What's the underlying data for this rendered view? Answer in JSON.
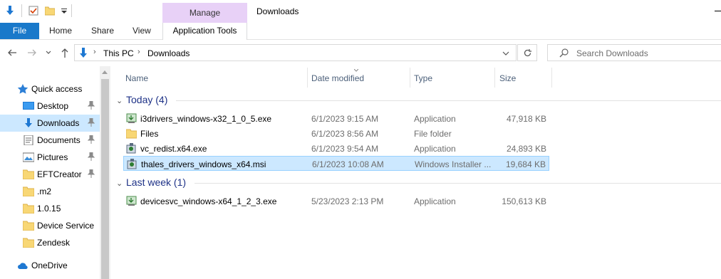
{
  "titlebar": {
    "manage_label": "Manage",
    "window_title": "Downloads"
  },
  "ribbon": {
    "file": "File",
    "home": "Home",
    "share": "Share",
    "view": "View",
    "app_tools": "Application Tools"
  },
  "address": {
    "root": "This PC",
    "current": "Downloads",
    "search_placeholder": "Search Downloads"
  },
  "nav": {
    "quick_access": "Quick access",
    "items": [
      {
        "label": "Desktop",
        "icon": "desktop-icon",
        "pinned": true
      },
      {
        "label": "Downloads",
        "icon": "downloads-icon",
        "pinned": true,
        "selected": true
      },
      {
        "label": "Documents",
        "icon": "documents-icon",
        "pinned": true
      },
      {
        "label": "Pictures",
        "icon": "pictures-icon",
        "pinned": true
      },
      {
        "label": "EFTCreator",
        "icon": "folder-icon",
        "pinned": true
      },
      {
        "label": ".m2",
        "icon": "folder-icon",
        "pinned": false
      },
      {
        "label": "1.0.15",
        "icon": "folder-icon",
        "pinned": false
      },
      {
        "label": "Device Service",
        "icon": "folder-icon",
        "pinned": false
      },
      {
        "label": "Zendesk",
        "icon": "folder-icon",
        "pinned": false
      }
    ],
    "onedrive": "OneDrive"
  },
  "columns": {
    "name": "Name",
    "date": "Date modified",
    "type": "Type",
    "size": "Size"
  },
  "groups": [
    {
      "label": "Today (4)",
      "files": [
        {
          "name": "i3drivers_windows-x32_1_0_5.exe",
          "date": "6/1/2023 9:15 AM",
          "type": "Application",
          "size": "47,918 KB",
          "icon": "installer-icon"
        },
        {
          "name": "Files",
          "date": "6/1/2023 8:56 AM",
          "type": "File folder",
          "size": "",
          "icon": "folder-icon"
        },
        {
          "name": "vc_redist.x64.exe",
          "date": "6/1/2023 9:54 AM",
          "type": "Application",
          "size": "24,893 KB",
          "icon": "setup-icon"
        },
        {
          "name": "thales_drivers_windows_x64.msi",
          "date": "6/1/2023 10:08 AM",
          "type": "Windows Installer ...",
          "size": "19,684 KB",
          "icon": "msi-icon",
          "selected": true
        }
      ]
    },
    {
      "label": "Last week (1)",
      "files": [
        {
          "name": "devicesvc_windows-x64_1_2_3.exe",
          "date": "5/23/2023 2:13 PM",
          "type": "Application",
          "size": "150,613 KB",
          "icon": "installer-icon"
        }
      ]
    }
  ],
  "colors": {
    "file_tab": "#1979ca",
    "manage_tab": "#e8d1f7",
    "selection": "#cce8ff",
    "group_header": "#1e3287"
  }
}
